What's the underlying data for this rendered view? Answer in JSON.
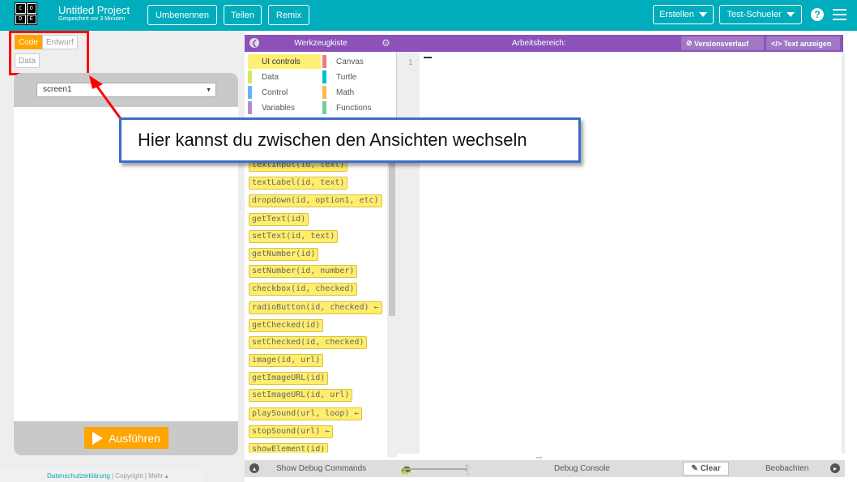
{
  "header": {
    "logo_letters": [
      "C",
      "O",
      "D",
      "E"
    ],
    "project_title": "Untitled Project",
    "saved_status": "Gespeichert vor 3 Minuten",
    "rename_label": "Umbenennen",
    "share_label": "Teilen",
    "remix_label": "Remix",
    "create_label": "Erstellen",
    "user_label": "Test-Schueler",
    "help_icon": "?",
    "menu_icon": "hamburger-icon",
    "accent_color": "#00adbc"
  },
  "view_toggle": {
    "code_label": "Code",
    "design_label": "Entwurf",
    "data_label": "Data",
    "active": "Code",
    "active_color": "#ffa400"
  },
  "app_preview": {
    "screen_select_value": "screen1",
    "run_label": "Ausführen"
  },
  "footer": {
    "privacy_label": "Datenschutzerklärung",
    "sep1": "|",
    "copyright_label": "Copyright",
    "sep2": "|",
    "more_label": "Mehr ▴"
  },
  "toolbox": {
    "title": "Werkzeugkiste",
    "categories": [
      {
        "label": "UI controls",
        "color": "#ffee77",
        "selected": true
      },
      {
        "label": "Canvas",
        "color": "#f27979"
      },
      {
        "label": "Data",
        "color": "#d3e965"
      },
      {
        "label": "Turtle",
        "color": "#00bcd4"
      },
      {
        "label": "Control",
        "color": "#64b5f6"
      },
      {
        "label": "Math",
        "color": "#ffb74d"
      },
      {
        "label": "Variables",
        "color": "#b987d1"
      },
      {
        "label": "Functions",
        "color": "#6fcf97"
      }
    ],
    "blocks": [
      "textInput(id, text)",
      "textLabel(id, text)",
      "dropdown(id, option1, etc)",
      "getText(id)",
      "setText(id, text)",
      "getNumber(id)",
      "setNumber(id, number)",
      "checkbox(id, checked)",
      "radioButton(id, checked) ←",
      "getChecked(id)",
      "setChecked(id, checked)",
      "image(id, url)",
      "getImageURL(id)",
      "setImageURL(id, url)",
      "playSound(url, loop) ←",
      "stopSound(url) ←",
      "showElement(id)"
    ]
  },
  "workspace": {
    "title": "Arbeitsbereich:",
    "history_label": "Versionsverlauf",
    "show_text_label": "Text anzeigen",
    "line_number": "1"
  },
  "debug": {
    "show_commands_label": "Show Debug Commands",
    "console_label": "Debug Console",
    "clear_label": "Clear",
    "watch_label": "Beobachten"
  },
  "callout": {
    "text": "Hier kannst du zwischen den Ansichten wechseln",
    "border_color": "#3b6ec6",
    "highlight_color": "#ff0000"
  }
}
